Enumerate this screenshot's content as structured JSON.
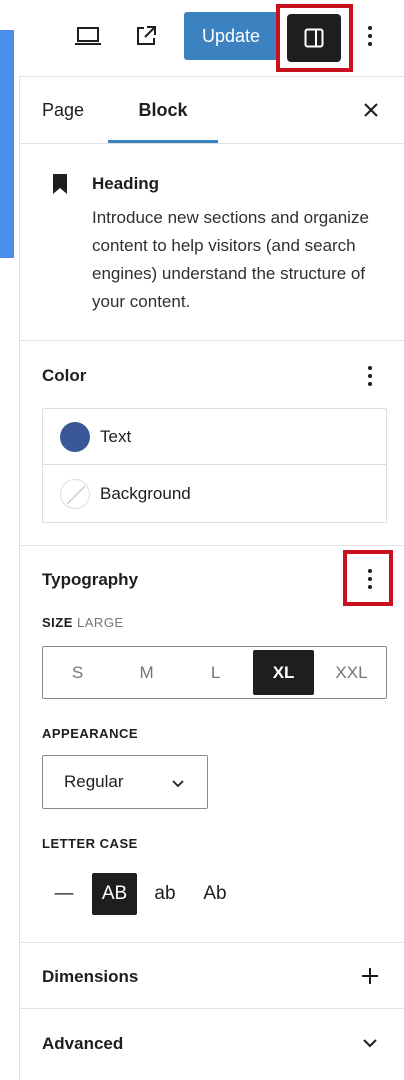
{
  "toolbar": {
    "update_label": "Update",
    "icons": [
      "laptop-icon",
      "external-link-icon",
      "sidebar-toggle-icon",
      "more-vertical-icon"
    ]
  },
  "tabs": {
    "page_label": "Page",
    "block_label": "Block",
    "close_icon": "close-icon"
  },
  "block": {
    "icon": "bookmark-icon",
    "title": "Heading",
    "description": "Introduce new sections and organize content to help visitors (and search engines) understand the structure of your content."
  },
  "color": {
    "title": "Color",
    "items": [
      {
        "label": "Text",
        "swatch": "#3a5798"
      },
      {
        "label": "Background",
        "swatch": "none"
      }
    ]
  },
  "typography": {
    "title": "Typography",
    "size_label": "SIZE",
    "size_value": "LARGE",
    "size_options": [
      "S",
      "M",
      "L",
      "XL",
      "XXL"
    ],
    "size_selected": "XL",
    "appearance_label": "APPEARANCE",
    "appearance_value": "Regular",
    "letter_case_label": "LETTER CASE",
    "letter_case_options": [
      "—",
      "AB",
      "ab",
      "Ab"
    ],
    "letter_case_selected": "AB"
  },
  "dimensions": {
    "title": "Dimensions",
    "icon": "plus-icon"
  },
  "advanced": {
    "title": "Advanced",
    "icon": "chevron-down-icon"
  },
  "colors": {
    "accent": "#3d82c0",
    "dark": "#1e1e1e",
    "highlight": "#c8101e",
    "left_strip": "#4a8ee8"
  }
}
